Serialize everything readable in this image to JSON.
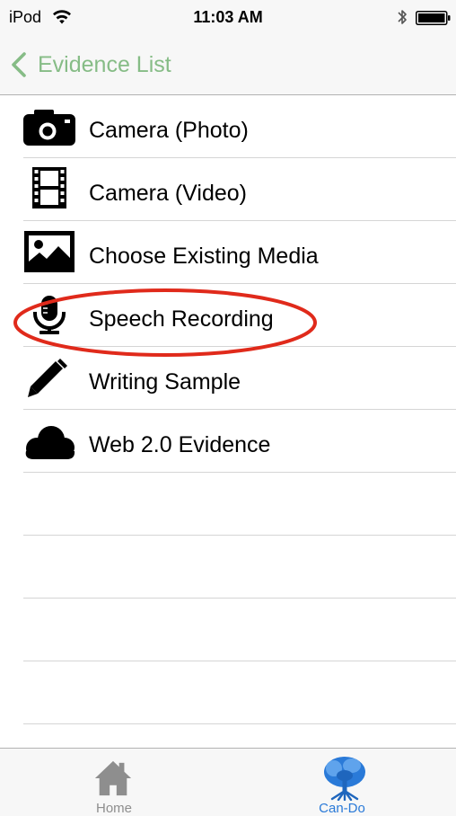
{
  "status_bar": {
    "carrier": "iPod",
    "time": "11:03 AM",
    "wifi_icon": "wifi-icon",
    "bluetooth_icon": "bluetooth-icon",
    "battery_icon": "battery-icon"
  },
  "nav": {
    "back_label": "Evidence List",
    "back_icon": "chevron-left-icon",
    "accent_color": "#86bc86"
  },
  "list": {
    "items": [
      {
        "label": "Camera (Photo)",
        "icon": "camera-icon"
      },
      {
        "label": "Camera (Video)",
        "icon": "film-strip-icon"
      },
      {
        "label": "Choose Existing Media",
        "icon": "image-icon"
      },
      {
        "label": "Speech Recording",
        "icon": "microphone-icon",
        "highlighted": true
      },
      {
        "label": "Writing Sample",
        "icon": "pencil-icon"
      },
      {
        "label": "Web 2.0 Evidence",
        "icon": "cloud-icon"
      }
    ],
    "highlight_color": "#e02a1b"
  },
  "tab_bar": {
    "tabs": [
      {
        "label": "Home",
        "icon": "home-icon",
        "selected": false
      },
      {
        "label": "Can-Do",
        "icon": "tree-icon",
        "selected": true
      }
    ],
    "selected_color": "#2a7ad8",
    "unselected_color": "#8e8e8e"
  }
}
